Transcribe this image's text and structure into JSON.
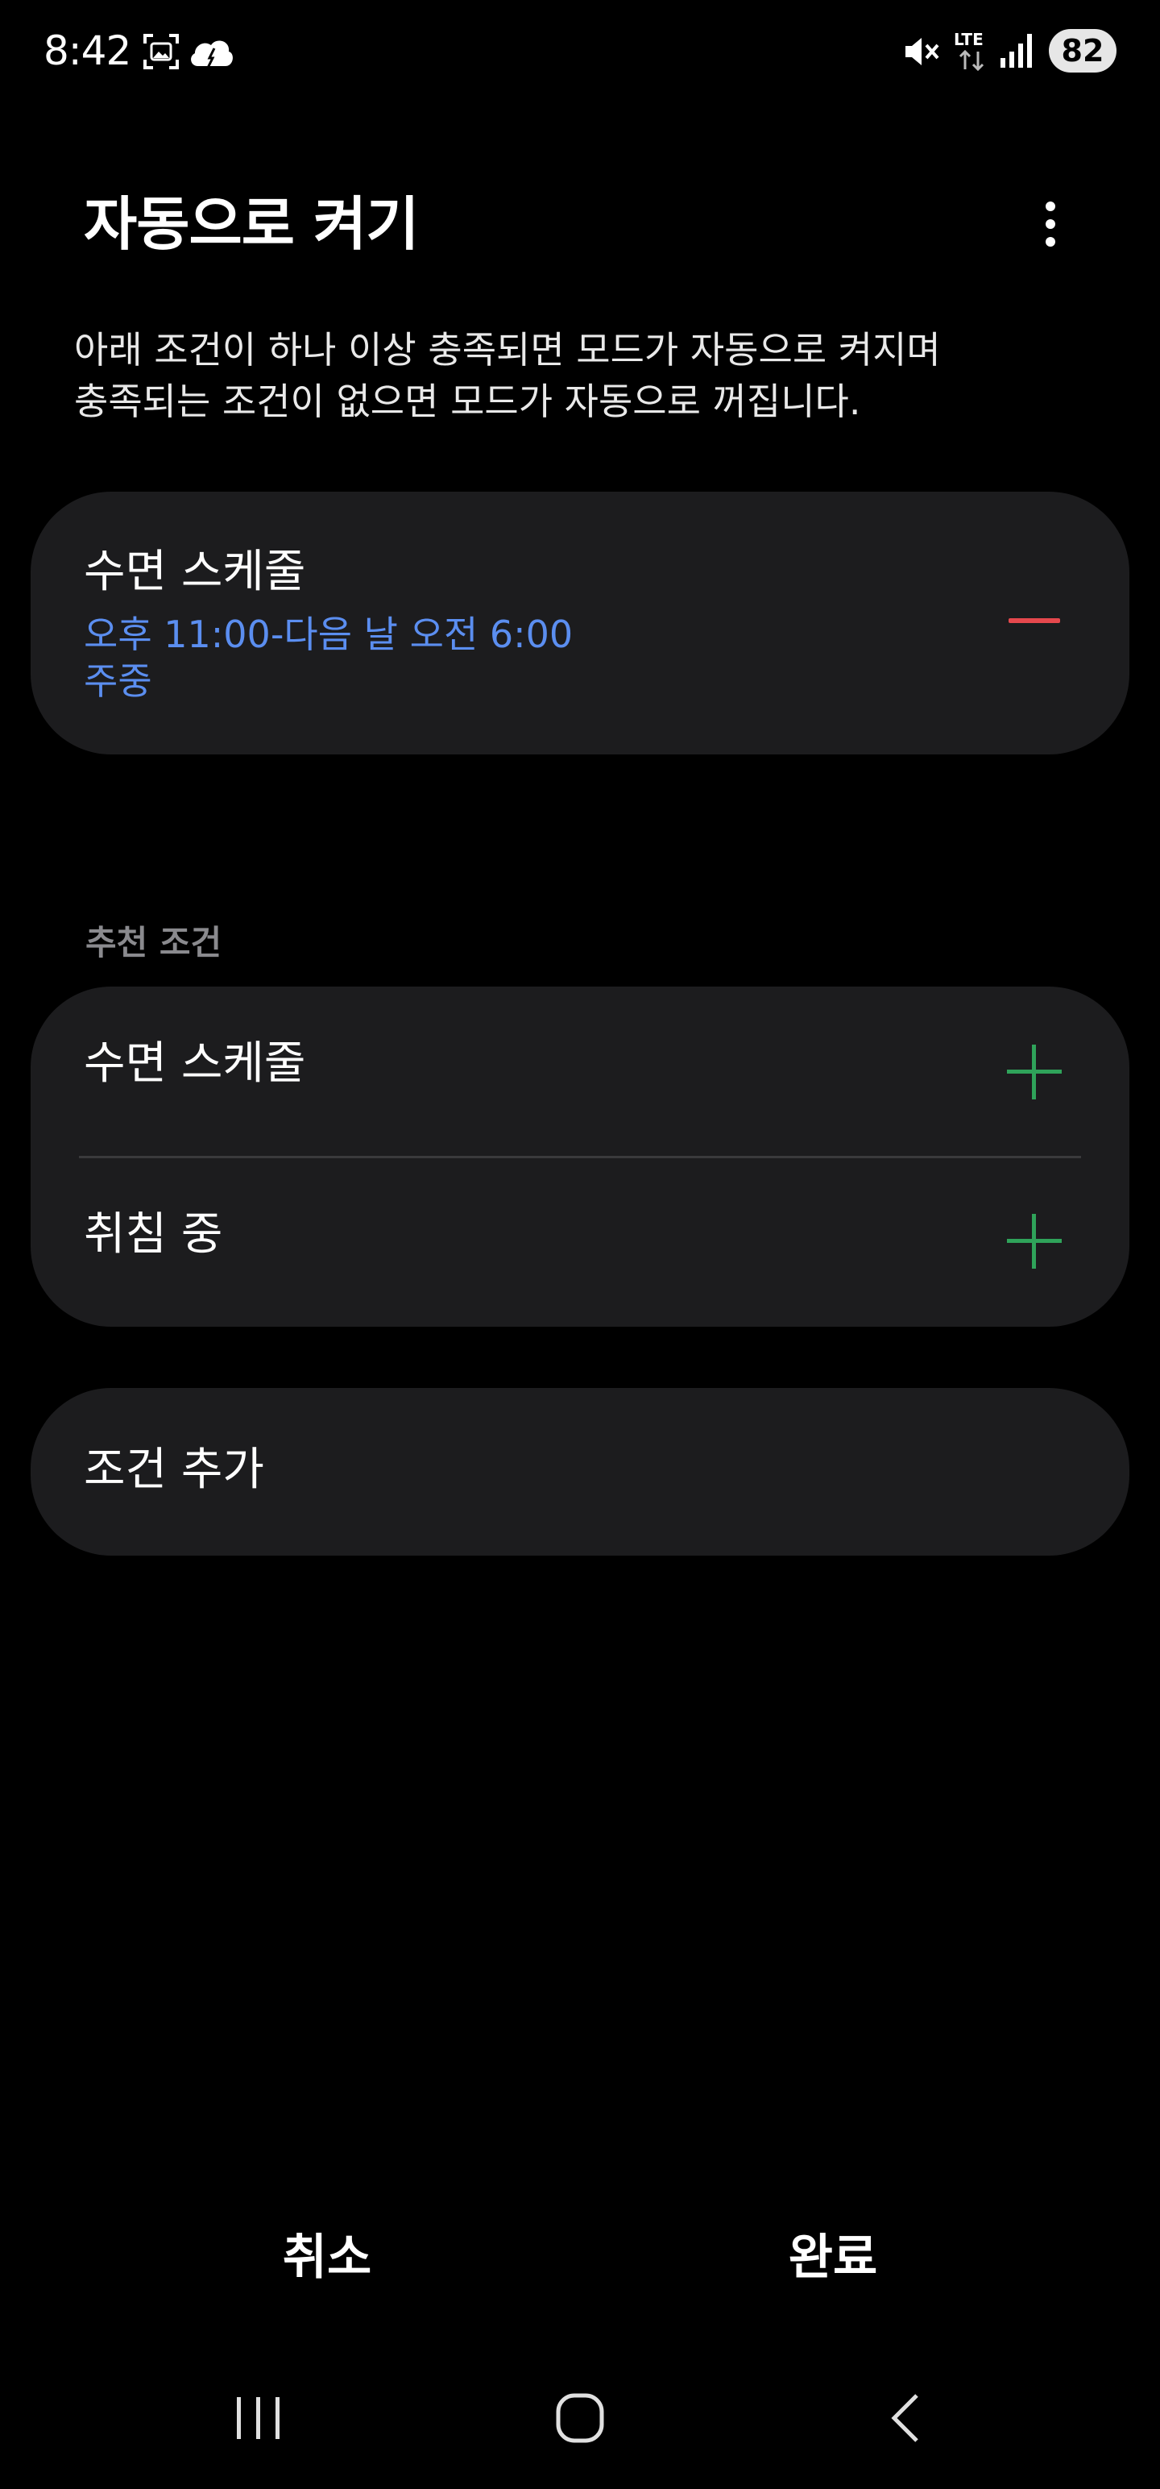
{
  "status_bar": {
    "time": "8:42",
    "battery": "82",
    "icons": [
      "screenshot-icon",
      "weather-icon",
      "mute-icon",
      "lte-icon",
      "signal-icon",
      "battery-icon"
    ]
  },
  "header": {
    "title": "자동으로 켜기",
    "more_icon": "more-vertical-icon"
  },
  "description": {
    "line1": "아래 조건이 하나 이상 충족되면 모드가 자동으로 켜지며",
    "line2": "충족되는 조건이 없으면 모드가 자동으로 꺼집니다."
  },
  "current_condition": {
    "title": "수면 스케줄",
    "time": "오후 11:00-다음 날 오전 6:00",
    "days": "주중",
    "action_icon": "remove-icon"
  },
  "recommended": {
    "label": "추천 조건",
    "items": [
      {
        "label": "수면 스케줄",
        "action_icon": "add-icon"
      },
      {
        "label": "취침 중",
        "action_icon": "add-icon"
      }
    ]
  },
  "add_condition": {
    "label": "조건 추가"
  },
  "footer": {
    "cancel": "취소",
    "done": "완료"
  },
  "navigation": {
    "recents_icon": "recents-icon",
    "home_icon": "home-icon",
    "back_icon": "back-icon"
  },
  "colors": {
    "background": "#000000",
    "card": "#1c1c1e",
    "accent_blue": "#5b8ef0",
    "remove_red": "#e5484d",
    "add_green": "#2fa35a",
    "section_gray": "#8a8a8e"
  }
}
